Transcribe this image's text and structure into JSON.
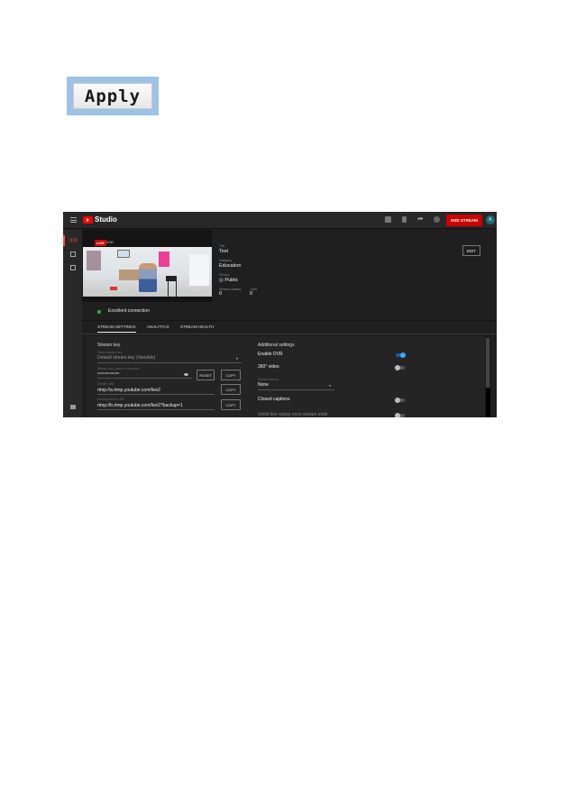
{
  "apply_button": {
    "label": "Apply"
  },
  "studio": {
    "brand": "Studio",
    "header": {
      "icons": [
        "closed-captions-icon",
        "bookmark-icon",
        "share-icon",
        "settings-icon"
      ],
      "end_stream_label": "END STREAM",
      "avatar_initial": "K"
    },
    "leftnav": {
      "live_icon": "((•))"
    },
    "preview": {
      "live_badge": "LIVE",
      "elapsed_time": "0:00"
    },
    "connection": {
      "status": "Excellent connection",
      "color": "#2ba640"
    },
    "details": {
      "title_label": "Title",
      "title_value": "Test",
      "category_label": "Category",
      "category_value": "Education",
      "privacy_label": "Privacy",
      "privacy_value": "Public",
      "viewers_label": "Viewers waiting",
      "viewers_value": "0",
      "likes_label": "Likes",
      "likes_value": "0",
      "edit_label": "EDIT"
    },
    "tabs": [
      {
        "label": "STREAM SETTINGS",
        "active": true
      },
      {
        "label": "ANALYTICS",
        "active": false
      },
      {
        "label": "STREAM HEALTH",
        "active": false
      }
    ],
    "stream_key": {
      "section_title": "Stream key",
      "select_label": "Select stream key",
      "select_value": "Default stream key (Variable)",
      "key_label": "Stream key (paste in encoder)",
      "key_value": "••••••••••••••••••••",
      "reset_label": "RESET",
      "copy_label": "COPY",
      "url_label": "Stream URL",
      "url_value": "rtmp://a.rtmp.youtube.com/live2",
      "backup_label": "Backup server URL",
      "backup_value": "rtmp://b.rtmp.youtube.com/live2?backup=1"
    },
    "additional": {
      "section_title": "Additional settings",
      "enable_dvr_label": "Enable DVR",
      "enable_dvr": true,
      "video_360_label": "360° video",
      "video_360": false,
      "latency_label": "Stream latency",
      "latency_value": "None",
      "closed_captions_label": "Closed captions",
      "closed_captions": false,
      "partial_row_label": "Unlist live replay once stream ends",
      "partial_row": false
    },
    "colors": {
      "accent_red": "#cc0000",
      "toggle_blue": "#3ea6ff",
      "background": "#1f1f1f"
    }
  }
}
